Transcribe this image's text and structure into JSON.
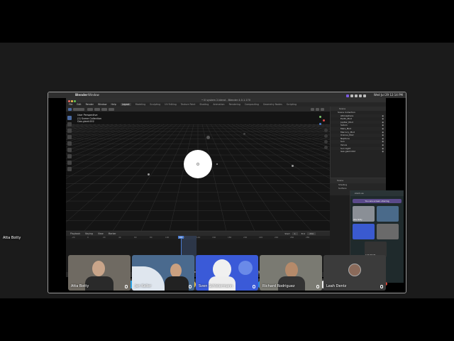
{
  "mac_menubar": {
    "app_name": "Blender",
    "menu_item": "Window",
    "clock": "Wed Jul 29 12:14 PM"
  },
  "blender": {
    "window_title": "• lil system 2.blend - Blender 4.0.1.170",
    "menus": [
      "File",
      "Edit",
      "Render",
      "Window",
      "Help"
    ],
    "workspaces": [
      "Layout",
      "Modeling",
      "Sculpting",
      "UV Editing",
      "Texture Paint",
      "Shading",
      "Animation",
      "Rendering",
      "Compositing",
      "Geometry Nodes",
      "Scripting"
    ],
    "active_workspace": "Layout",
    "viewport_info": [
      "User Perspective",
      "(1) Scene Collection",
      "Gas giant.002"
    ],
    "timeline": {
      "menus": [
        "Playback",
        "Keying",
        "View",
        "Marker"
      ],
      "start_label": "Start",
      "start_value": "1",
      "end_label": "End",
      "end_value": "250",
      "current_frame": "101",
      "ruler": [
        "-20",
        "0",
        "20",
        "40",
        "60",
        "80",
        "100",
        "120",
        "140",
        "160",
        "180",
        "200",
        "220",
        "240",
        "260",
        "280"
      ]
    },
    "outliner": {
      "header": "Scene",
      "items": [
        "Scene Collection",
        "Atmosphere",
        "Earth_Mod",
        "Jupiter_Mod",
        "Saturn",
        "Mars_Mod",
        "Mercury_Mod",
        "Uranus_Mod",
        "Neptune",
        "Sun",
        "Venus",
        "Sun Light",
        "Gas giant.002"
      ]
    },
    "properties": {
      "header": "Scene",
      "items": [
        "Shading",
        "Surface"
      ]
    },
    "status_text": "Select   Rotate View   Object"
  },
  "meet_panel": {
    "header": "zoom.us",
    "sharing_label": "You are screen sharing",
    "tiles": [
      "Atta Botty",
      "",
      "",
      "",
      "Leah Dentz"
    ]
  },
  "share_banner": {
    "text": "www.zoom.com is sharing your screen.",
    "stop_label": "Stop sharing",
    "hide_label": "Hide"
  },
  "presenter": {
    "name": "Atta Botty"
  },
  "participants": [
    {
      "name": "Atta Botty"
    },
    {
      "name": "Jan Keller"
    },
    {
      "name": "Sven Schleiermann"
    },
    {
      "name": "Richard Rodriguez"
    },
    {
      "name": "Leah Dentz"
    }
  ],
  "colors": {
    "accent": "#4a7bd0",
    "end_call": "#e04a3a",
    "share_purple": "#5a4a8a"
  }
}
